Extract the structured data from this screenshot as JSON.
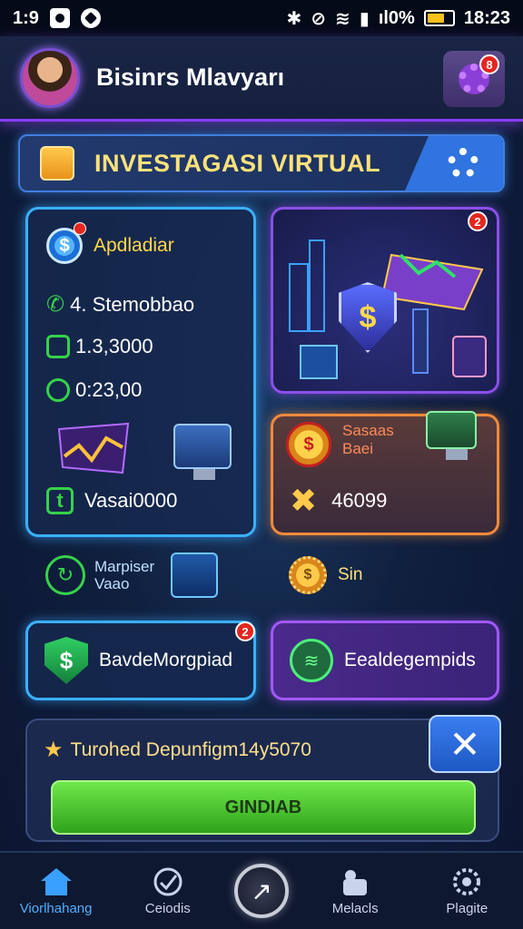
{
  "status_bar": {
    "time_left": "1:9",
    "battery_percent": "ıl0%",
    "clock": "18:23"
  },
  "header": {
    "title": "Bisinrs Mlavyarı",
    "settings_badge": "8"
  },
  "banner": {
    "title": "INVESTAGASI VIRTUAL"
  },
  "main_card": {
    "label": "Apdladiar",
    "stats": [
      "4. Stemobbao",
      "1.3,3000",
      "0:23,00"
    ],
    "footer_value": "Vasai0000"
  },
  "purple_card": {
    "badge": "2"
  },
  "orange_card": {
    "title_line1": "Sasaas",
    "title_line2": "Baei",
    "value": "46099"
  },
  "mid_row": {
    "left_label_line1": "Marpiser",
    "left_label_line2": "Vaao",
    "right_label": "Sin"
  },
  "pills": {
    "left_label": "BavdeMorgpiad",
    "left_badge": "2",
    "right_label": "Eealdegempids"
  },
  "bottom_panel": {
    "text": "Turohed Depunfigm14y5070",
    "cta_label": "GINDIAB",
    "close_symbol": "✕"
  },
  "navbar": {
    "items": [
      {
        "label": "Viorlhahang",
        "active": true
      },
      {
        "label": "Ceiodis",
        "active": false
      },
      {
        "label": "Melacls",
        "active": false
      },
      {
        "label": "Plagite",
        "active": false
      }
    ]
  },
  "colors": {
    "accent_blue": "#3ab0ff",
    "accent_purple": "#8c4fe8",
    "accent_orange": "#f08a3c",
    "cta_green": "#2fa31c"
  }
}
